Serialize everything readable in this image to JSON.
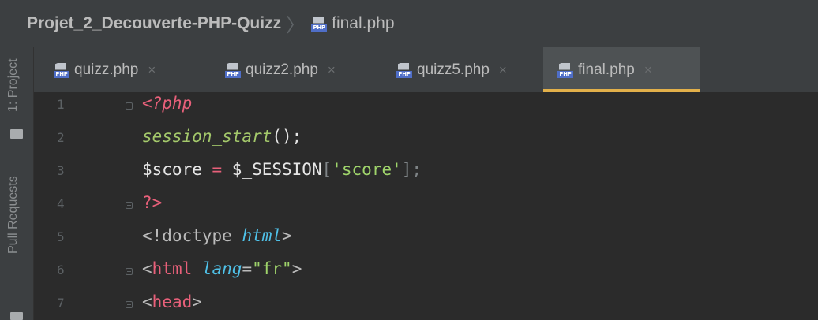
{
  "breadcrumb": {
    "project": "Projet_2_Decouverte-PHP-Quizz",
    "separator": "〉",
    "file": "final.php",
    "file_icon": "php-file-icon",
    "file_icon_text": "PHP"
  },
  "side": {
    "project_label": "1: Project",
    "pull_requests_label": "Pull Requests"
  },
  "tabs": [
    {
      "label": "quizz.php",
      "close": "×",
      "active": false
    },
    {
      "label": "quizz2.php",
      "close": "×",
      "active": false
    },
    {
      "label": "quizz5.php",
      "close": "×",
      "active": false
    },
    {
      "label": "final.php",
      "close": "×",
      "active": true
    }
  ],
  "editor": {
    "line_numbers": [
      "1",
      "2",
      "3",
      "4",
      "5",
      "6",
      "7"
    ],
    "line1": {
      "open_tag": "<?php"
    },
    "line2": {
      "func": "session_start",
      "rest": "();"
    },
    "line3": {
      "var": "$score",
      "eq": " = ",
      "session": "$_SESSION",
      "lb": "[",
      "key": "'score'",
      "rb": "]",
      "semi": ";"
    },
    "line4": {
      "close_tag": "?>"
    },
    "line5": {
      "pre": "<!doctype ",
      "html": "html",
      "post": ">"
    },
    "line6": {
      "lt": "<",
      "tag": "html",
      "attr": " lang",
      "eq": "=",
      "val": "\"fr\"",
      "gt": ">"
    },
    "line7": {
      "lt": "<",
      "tag": "head",
      "gt": ">"
    }
  },
  "colors": {
    "accent_tab_underline": "#e2b04a",
    "background": "#2b2b2b",
    "php_badge": "#4f6ec7"
  }
}
